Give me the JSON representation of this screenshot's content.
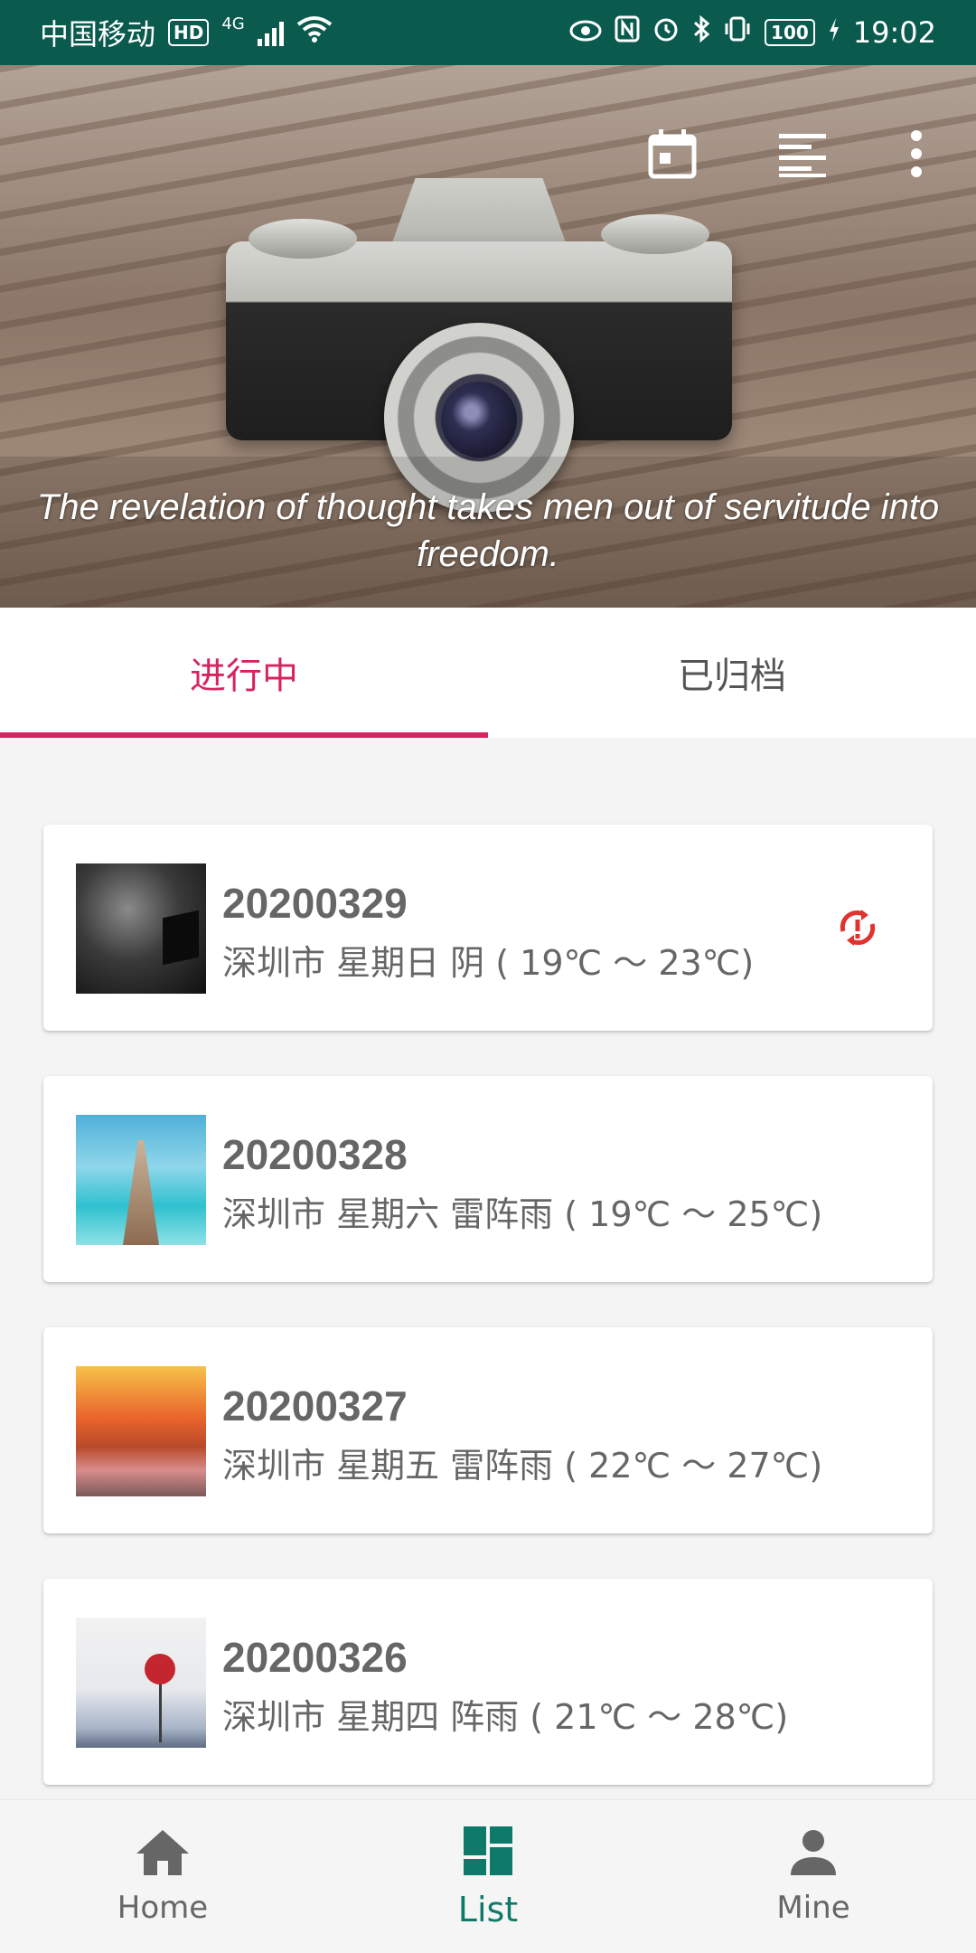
{
  "status_bar": {
    "carrier": "中国移动",
    "hd": "HD",
    "network": "4G",
    "battery": "100",
    "time": "19:02"
  },
  "header": {
    "quote": "The revelation of thought takes men out of servitude into freedom.",
    "icons": [
      "calendar-icon",
      "list-view-icon",
      "more-vert-icon"
    ]
  },
  "tabs": [
    {
      "label": "进行中",
      "active": true
    },
    {
      "label": "已归档",
      "active": false
    }
  ],
  "entries": [
    {
      "date": "20200329",
      "info": "深圳市 星期日 阴 ( 19℃ ～ 23℃)",
      "sync_pending": true
    },
    {
      "date": "20200328",
      "info": "深圳市 星期六 雷阵雨 ( 19℃ ～ 25℃)"
    },
    {
      "date": "20200327",
      "info": "深圳市 星期五 雷阵雨 ( 22℃ ～ 27℃)"
    },
    {
      "date": "20200326",
      "info": "深圳市 星期四 阵雨 ( 21℃ ～ 28℃)"
    }
  ],
  "colors": {
    "status_bar": "#0b5a4e",
    "accent": "#d6245f",
    "nav_active": "#0e7a6a",
    "sync_icon": "#e0332f"
  },
  "bottom_nav": [
    {
      "label": "Home",
      "icon": "home-icon",
      "active": false
    },
    {
      "label": "List",
      "icon": "dashboard-icon",
      "active": true
    },
    {
      "label": "Mine",
      "icon": "person-icon",
      "active": false
    }
  ]
}
